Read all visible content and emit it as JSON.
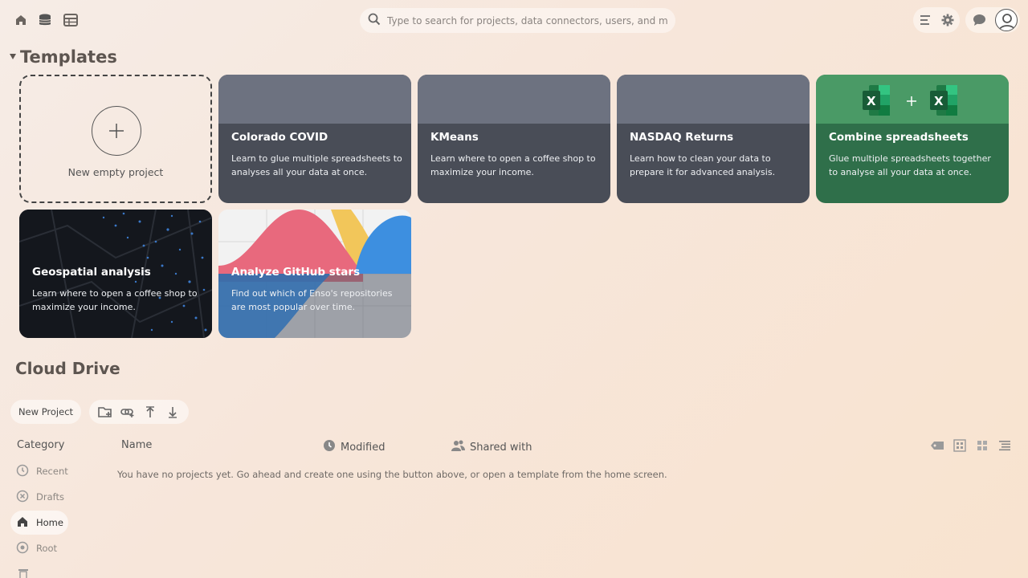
{
  "search": {
    "placeholder": "Type to search for projects, data connectors, users, and more."
  },
  "templates": {
    "section_title": "Templates",
    "new_project_label": "New empty project",
    "cards": [
      {
        "title": "Colorado COVID",
        "description": "Learn to glue multiple spreadsheets to analyses all your data at once."
      },
      {
        "title": "KMeans",
        "description": "Learn where to open a coffee shop to maximize your income."
      },
      {
        "title": "NASDAQ Returns",
        "description": "Learn how to clean your data to prepare it for advanced analysis."
      },
      {
        "title": "Combine spreadsheets",
        "description": "Glue multiple spreadsheets together to analyse all your data at once."
      },
      {
        "title": "Geospatial analysis",
        "description": "Learn where to open a coffee shop to maximize your income."
      },
      {
        "title": "Analyze GitHub stars",
        "description": "Find out which of Enso's repositories are most popular over time."
      }
    ]
  },
  "drive": {
    "title": "Cloud Drive",
    "new_project_button": "New Project",
    "columns": {
      "category": "Category",
      "name": "Name",
      "modified": "Modified",
      "shared_with": "Shared with"
    },
    "categories": [
      {
        "label": "Recent",
        "icon": "clock-icon",
        "active": false
      },
      {
        "label": "Drafts",
        "icon": "drafts-icon",
        "active": false
      },
      {
        "label": "Home",
        "icon": "home-icon",
        "active": true
      },
      {
        "label": "Root",
        "icon": "root-icon",
        "active": false
      }
    ],
    "empty_message": "You have no projects yet. Go ahead and create one using the button above, or open a template from the home screen."
  },
  "colors": {
    "card_dark": "#494d57",
    "card_top": "#6d7280",
    "excel_green": "#2f6f4a",
    "excel_top": "#4a9a66"
  }
}
